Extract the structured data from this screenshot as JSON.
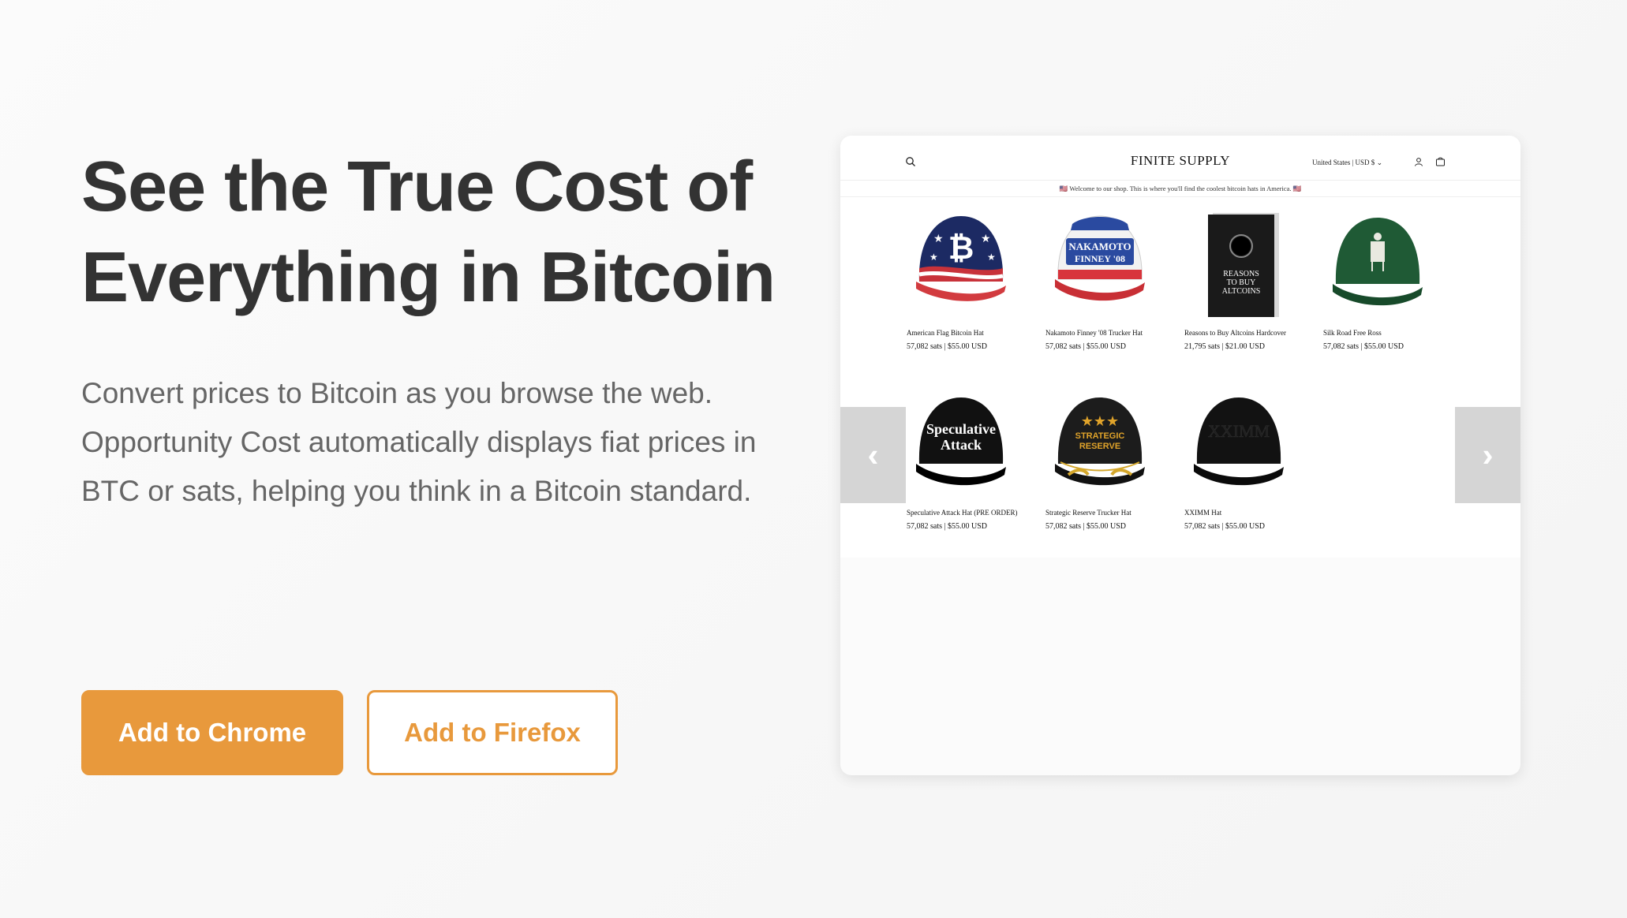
{
  "hero": {
    "title": "See the True Cost of Everything in Bitcoin",
    "description": "Convert prices to Bitcoin as you browse the web. Opportunity Cost automatically displays fiat prices in BTC or sats, helping you think in a Bitcoin standard."
  },
  "cta": {
    "chrome_label": "Add to Chrome",
    "firefox_label": "Add to Firefox"
  },
  "colors": {
    "accent": "#e8993c",
    "title": "#333333",
    "body": "#666666"
  },
  "preview": {
    "shop_title": "FINITE SUPPLY",
    "region": "United States | USD $",
    "banner": "🇺🇸 Welcome to our shop. This is where you'll find the coolest bitcoin hats in America. 🇺🇸",
    "prev_label": "‹",
    "next_label": "›",
    "products": [
      {
        "name": "American Flag Bitcoin Hat",
        "price": "57,082 sats  |  $55.00 USD"
      },
      {
        "name": "Nakamoto Finney '08 Trucker Hat",
        "price": "57,082 sats  |  $55.00 USD"
      },
      {
        "name": "Reasons to Buy Altcoins Hardcover",
        "price": "21,795 sats  |  $21.00 USD"
      },
      {
        "name": "Silk Road Free Ross",
        "price": "57,082 sats  |  $55.00 USD"
      },
      {
        "name": "Speculative Attack Hat (PRE ORDER)",
        "price": "57,082 sats  |  $55.00 USD"
      },
      {
        "name": "Strategic Reserve Trucker Hat",
        "price": "57,082 sats  |  $55.00 USD"
      },
      {
        "name": "XXIMM Hat",
        "price": "57,082 sats  |  $55.00 USD"
      }
    ],
    "image_text": {
      "bitcoin_symbol": "₿",
      "nakamoto": "NAKAMOTO",
      "finney": "FINNEY '08",
      "book": [
        "REASONS",
        "TO BUY",
        "ALTCOINS"
      ],
      "speculative": [
        "Speculative",
        "Attack"
      ],
      "stars": "★★★",
      "strategic": [
        "STRATEGIC",
        "RESERVE"
      ],
      "xximm": "XXIMM"
    }
  }
}
